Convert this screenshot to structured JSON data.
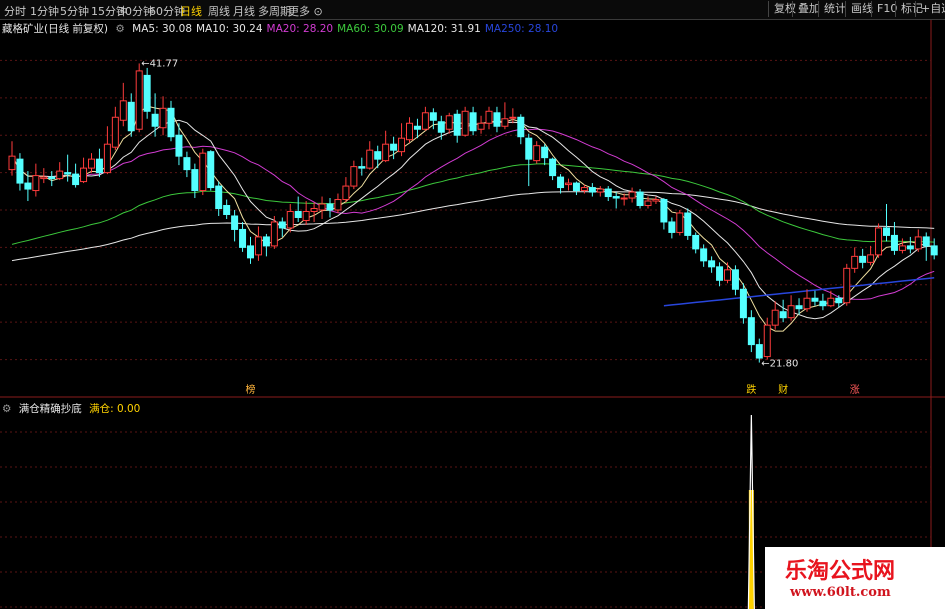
{
  "toolbar": {
    "periods": [
      "分时",
      "1分钟",
      "5分钟",
      "15分钟",
      "30分钟",
      "60分钟",
      "日线",
      "周线",
      "月线",
      "多周期",
      "更多"
    ],
    "active_period": "日线",
    "right_buttons": [
      "复权",
      "叠加",
      "统计",
      "画线",
      "F10",
      "标记",
      "+自选"
    ]
  },
  "main_legend": {
    "stock_name": "藏格矿业(日线 前复权)",
    "indicators": [
      {
        "label": "MA5: 30.08",
        "color": "#e6e6e6"
      },
      {
        "label": "MA10: 30.24",
        "color": "#e6e6e6"
      },
      {
        "label": "MA20: 28.20",
        "color": "#d23cd2"
      },
      {
        "label": "MA60: 30.09",
        "color": "#3cc83c"
      },
      {
        "label": "MA120: 31.91",
        "color": "#e6e6e6"
      },
      {
        "label": "MA250: 28.10",
        "color": "#2846dc"
      }
    ]
  },
  "sub_legend": {
    "name": "满仓精确抄底",
    "indicator_label": "满仓: 0.00",
    "label_color": "#ffd200"
  },
  "chart_data": [
    {
      "type": "candlestick",
      "title": "",
      "ylim": [
        20.5,
        43.5
      ],
      "up_color": "#ff3c3c",
      "down_color": "#54ffff",
      "max_label": "41.77",
      "min_label": "21.80",
      "markers": [
        {
          "index": 30,
          "text": "榜",
          "color": "#ffb43c"
        },
        {
          "index": 93,
          "text": "跌",
          "color": "#ffd200"
        },
        {
          "index": 97,
          "text": "财",
          "color": "#ffd200"
        },
        {
          "index": 106,
          "text": "涨",
          "color": "#ff5a5a"
        }
      ],
      "candles": [
        [
          34.7,
          35.6,
          36.6,
          34.3
        ],
        [
          35.4,
          33.8,
          35.8,
          33.3
        ],
        [
          33.8,
          33.4,
          34.6,
          32.6
        ],
        [
          33.3,
          34.3,
          35.1,
          32.9
        ],
        [
          34.1,
          34.2,
          34.8,
          33.8
        ],
        [
          34.2,
          34.1,
          34.6,
          33.6
        ],
        [
          34.1,
          34.6,
          35.2,
          34.0
        ],
        [
          34.5,
          34.4,
          35.7,
          33.9
        ],
        [
          34.4,
          33.7,
          35.1,
          33.5
        ],
        [
          33.9,
          34.8,
          35.5,
          33.8
        ],
        [
          34.8,
          35.4,
          35.8,
          34.5
        ],
        [
          35.4,
          34.5,
          36.1,
          34.2
        ],
        [
          34.5,
          36.4,
          37.6,
          34.4
        ],
        [
          36.2,
          38.2,
          38.9,
          36.0
        ],
        [
          38.0,
          39.3,
          40.5,
          37.6
        ],
        [
          39.2,
          37.3,
          39.8,
          36.9
        ],
        [
          37.4,
          41.3,
          41.8,
          37.2
        ],
        [
          41.0,
          38.6,
          41.5,
          38.1
        ],
        [
          38.4,
          37.6,
          39.8,
          36.9
        ],
        [
          37.5,
          38.8,
          39.6,
          37.0
        ],
        [
          38.8,
          36.9,
          39.3,
          36.6
        ],
        [
          37.0,
          35.6,
          37.8,
          35.0
        ],
        [
          35.5,
          34.7,
          35.9,
          34.2
        ],
        [
          34.7,
          33.3,
          35.1,
          32.8
        ],
        [
          33.3,
          35.8,
          36.1,
          33.0
        ],
        [
          35.9,
          33.5,
          36.0,
          33.3
        ],
        [
          33.6,
          32.1,
          33.9,
          31.6
        ],
        [
          32.3,
          31.7,
          32.7,
          31.4
        ],
        [
          31.6,
          30.7,
          32.0,
          29.9
        ],
        [
          30.7,
          29.5,
          31.2,
          29.2
        ],
        [
          29.6,
          28.8,
          30.2,
          28.4
        ],
        [
          29.0,
          30.2,
          30.9,
          28.6
        ],
        [
          30.2,
          29.6,
          30.4,
          28.9
        ],
        [
          29.6,
          31.2,
          31.6,
          29.4
        ],
        [
          31.2,
          30.8,
          31.5,
          30.2
        ],
        [
          30.8,
          31.9,
          32.4,
          30.5
        ],
        [
          31.9,
          31.5,
          32.9,
          31.2
        ],
        [
          31.3,
          31.9,
          32.6,
          31.0
        ],
        [
          31.9,
          32.1,
          32.5,
          31.2
        ],
        [
          32.0,
          32.4,
          32.9,
          31.4
        ],
        [
          32.4,
          32.0,
          32.8,
          31.5
        ],
        [
          32.0,
          32.7,
          33.1,
          31.8
        ],
        [
          32.7,
          33.6,
          34.2,
          32.5
        ],
        [
          33.6,
          34.9,
          35.3,
          33.4
        ],
        [
          34.9,
          34.8,
          35.5,
          34.3
        ],
        [
          34.8,
          36.0,
          36.6,
          34.7
        ],
        [
          35.9,
          35.4,
          36.3,
          34.8
        ],
        [
          35.3,
          36.4,
          37.3,
          35.2
        ],
        [
          36.4,
          36.0,
          36.9,
          35.4
        ],
        [
          35.9,
          36.8,
          37.8,
          35.6
        ],
        [
          36.7,
          37.8,
          38.2,
          36.5
        ],
        [
          37.6,
          37.4,
          38.1,
          36.8
        ],
        [
          37.4,
          38.5,
          38.9,
          37.3
        ],
        [
          38.5,
          38.0,
          38.8,
          37.4
        ],
        [
          37.9,
          37.2,
          38.3,
          36.7
        ],
        [
          37.4,
          38.3,
          38.5,
          37.1
        ],
        [
          38.4,
          37.0,
          38.7,
          36.5
        ],
        [
          37.0,
          38.6,
          38.9,
          36.9
        ],
        [
          38.5,
          37.3,
          38.9,
          37.0
        ],
        [
          37.4,
          37.8,
          38.3,
          37.1
        ],
        [
          37.8,
          38.6,
          38.9,
          37.4
        ],
        [
          38.5,
          37.6,
          38.9,
          37.2
        ],
        [
          37.6,
          38.1,
          39.2,
          37.4
        ],
        [
          38.2,
          38.2,
          38.8,
          37.8
        ],
        [
          38.2,
          36.9,
          38.4,
          36.4
        ],
        [
          36.8,
          35.4,
          37.1,
          33.6
        ],
        [
          35.3,
          36.3,
          36.6,
          35.1
        ],
        [
          36.2,
          35.5,
          36.4,
          35.0
        ],
        [
          35.4,
          34.3,
          35.5,
          34.0
        ],
        [
          34.2,
          33.5,
          34.4,
          33.1
        ],
        [
          33.7,
          33.8,
          34.1,
          33.3
        ],
        [
          33.8,
          33.3,
          33.9,
          33.0
        ],
        [
          33.3,
          33.5,
          33.7,
          33.1
        ],
        [
          33.5,
          33.2,
          33.8,
          32.9
        ],
        [
          33.2,
          33.4,
          33.6,
          32.9
        ],
        [
          33.4,
          32.9,
          33.6,
          32.6
        ],
        [
          32.9,
          32.8,
          33.2,
          32.1
        ],
        [
          32.8,
          32.8,
          33.1,
          32.3
        ],
        [
          32.8,
          33.2,
          33.5,
          32.5
        ],
        [
          33.2,
          32.3,
          33.4,
          32.1
        ],
        [
          32.3,
          32.6,
          32.9,
          32.1
        ],
        [
          32.6,
          32.7,
          32.9,
          32.4
        ],
        [
          32.7,
          31.2,
          32.8,
          30.7
        ],
        [
          31.2,
          30.5,
          31.5,
          30.1
        ],
        [
          30.5,
          31.8,
          32.0,
          30.3
        ],
        [
          31.8,
          30.3,
          32.1,
          30.0
        ],
        [
          30.3,
          29.4,
          30.5,
          29.1
        ],
        [
          29.4,
          28.6,
          29.7,
          28.2
        ],
        [
          28.6,
          28.2,
          28.9,
          27.8
        ],
        [
          28.2,
          27.3,
          28.5,
          26.9
        ],
        [
          27.3,
          28.0,
          28.5,
          27.1
        ],
        [
          28.0,
          26.7,
          28.3,
          26.3
        ],
        [
          26.7,
          24.8,
          27.1,
          24.4
        ],
        [
          24.8,
          23.0,
          25.3,
          22.5
        ],
        [
          23.0,
          22.1,
          23.4,
          21.8
        ],
        [
          22.2,
          24.3,
          24.8,
          22.0
        ],
        [
          24.3,
          25.3,
          25.9,
          24.0
        ],
        [
          25.2,
          24.8,
          26.0,
          24.5
        ],
        [
          24.8,
          25.6,
          26.3,
          24.6
        ],
        [
          25.6,
          25.4,
          26.1,
          25.0
        ],
        [
          25.4,
          26.1,
          26.7,
          25.2
        ],
        [
          26.1,
          25.9,
          26.6,
          25.6
        ],
        [
          25.9,
          25.6,
          26.4,
          25.3
        ],
        [
          25.6,
          26.1,
          26.6,
          25.5
        ],
        [
          26.1,
          25.8,
          26.3,
          25.5
        ],
        [
          25.8,
          28.1,
          28.4,
          25.6
        ],
        [
          28.1,
          28.9,
          29.5,
          27.8
        ],
        [
          28.9,
          28.5,
          29.4,
          28.1
        ],
        [
          28.5,
          29.0,
          29.6,
          28.3
        ],
        [
          29.0,
          30.8,
          31.1,
          28.8
        ],
        [
          30.8,
          30.3,
          32.4,
          29.9
        ],
        [
          30.3,
          29.3,
          31.2,
          29.0
        ],
        [
          29.3,
          29.6,
          30.1,
          29.1
        ],
        [
          29.6,
          29.4,
          30.2,
          29.1
        ],
        [
          29.4,
          30.2,
          30.7,
          29.2
        ],
        [
          30.2,
          29.6,
          30.5,
          28.6
        ],
        [
          29.6,
          29.0,
          30.1,
          28.7
        ]
      ]
    },
    {
      "type": "bar",
      "title": "",
      "categories_note": "",
      "ylim": [
        0,
        1
      ],
      "spike_index": 93,
      "series": [
        {
          "name": "满仓",
          "values_nonzero": {
            "93": 1
          }
        }
      ]
    }
  ],
  "watermark": {
    "title": "乐淘公式网",
    "url": "www.60lt.com"
  }
}
